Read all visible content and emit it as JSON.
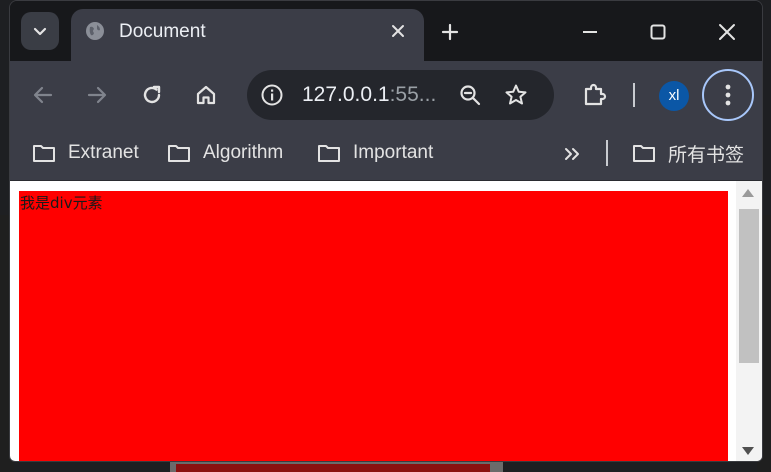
{
  "tab": {
    "title": "Document",
    "favicon": "globe-icon"
  },
  "toolbar": {
    "url_main": "127.0.0.1",
    "url_rest": ":55...",
    "profile_initials": "xl"
  },
  "bookmarks": [
    {
      "label": "Extranet",
      "icon": "folder-icon"
    },
    {
      "label": "Algorithm",
      "icon": "folder-icon"
    },
    {
      "label": "Important",
      "icon": "folder-icon"
    }
  ],
  "all_bookmarks_label": "所有书签",
  "page": {
    "div_text": "我是div元素",
    "div_color": "#ff0000"
  },
  "theme": {
    "chrome_dark": "#3b3d47",
    "accent_ring": "#a8c7fa",
    "avatar": "#0b57a6"
  }
}
